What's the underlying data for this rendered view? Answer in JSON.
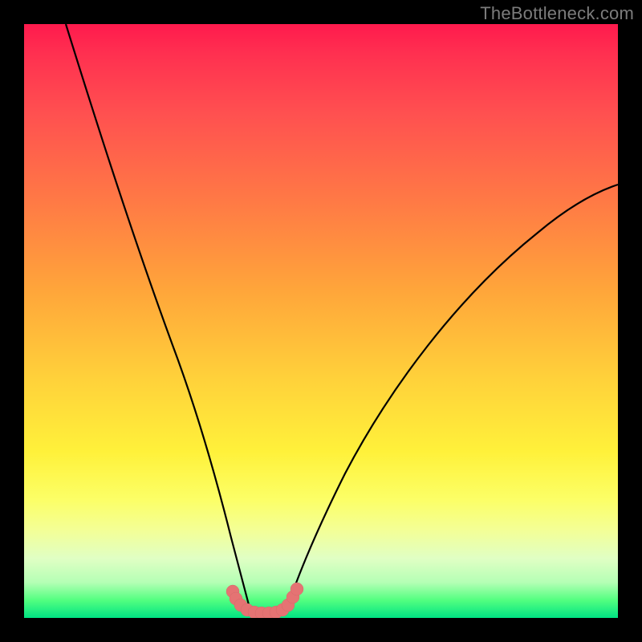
{
  "watermark": {
    "text": "TheBottleneck.com"
  },
  "chart_data": {
    "type": "line",
    "title": "",
    "xlabel": "",
    "ylabel": "",
    "xlim": [
      0,
      100
    ],
    "ylim": [
      0,
      100
    ],
    "grid": false,
    "series": [
      {
        "name": "left-curve",
        "x": [
          7,
          10,
          15,
          20,
          25,
          28,
          30,
          32,
          34,
          36,
          37,
          38
        ],
        "y": [
          100,
          89,
          72,
          55,
          38,
          27,
          19,
          12,
          6,
          2.5,
          1,
          0
        ]
      },
      {
        "name": "right-curve",
        "x": [
          44,
          46,
          48,
          52,
          58,
          66,
          75,
          85,
          95,
          100
        ],
        "y": [
          0,
          3,
          7,
          15,
          27,
          40,
          52,
          62,
          70,
          73
        ]
      },
      {
        "name": "bar-segment",
        "x": [
          35,
          36,
          37,
          38,
          39,
          40,
          41,
          42,
          43,
          44,
          45,
          47
        ],
        "y": [
          3.5,
          2.2,
          1.2,
          0.5,
          0.3,
          0.3,
          0.3,
          0.5,
          0.8,
          1.5,
          2.5,
          4
        ]
      }
    ],
    "annotations": []
  },
  "colors": {
    "curve": "#000000",
    "bar": "#e57373",
    "background_top": "#ff1a4d",
    "background_bottom": "#00e383"
  }
}
